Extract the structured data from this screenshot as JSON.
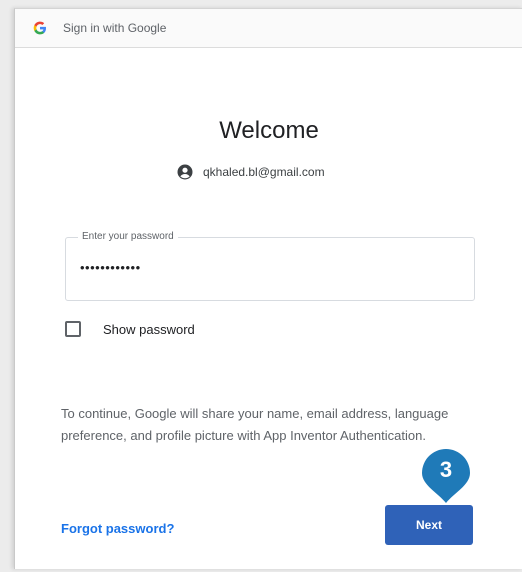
{
  "window": {
    "title": "Sign in with Google"
  },
  "heading": "Welcome",
  "account": {
    "email": "qkhaled.bl@gmail.com",
    "icon": "account-circle-icon"
  },
  "password_field": {
    "label": "Enter your password",
    "value": "••••••••••••"
  },
  "show_password": {
    "label": "Show password",
    "checked": false
  },
  "info_text": "To continue, Google will share your name, email address, language preference, and profile picture with App Inventor Authentication.",
  "forgot_link": "Forgot password?",
  "next_button": "Next",
  "step_marker": {
    "number": "3",
    "color": "#1f7ab8"
  },
  "colors": {
    "primary_button": "#2f62b8",
    "link": "#1a73e8"
  }
}
